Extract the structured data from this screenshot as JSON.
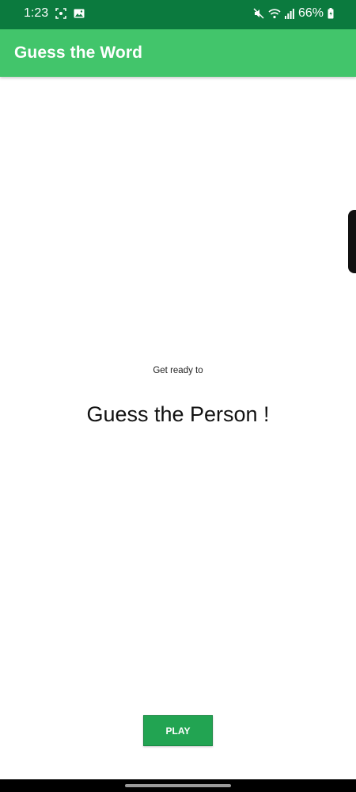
{
  "status_bar": {
    "time": "1:23",
    "battery": "66%",
    "icons": [
      "screenshot-icon",
      "image-icon",
      "mute-icon",
      "wifi-icon",
      "signal-icon",
      "battery-icon"
    ]
  },
  "app_bar": {
    "title": "Guess the Word"
  },
  "main": {
    "subtitle": "Get ready to",
    "headline": "Guess the Person !",
    "play_label": "PLAY"
  },
  "colors": {
    "status_bar": "#0b7a3e",
    "app_bar": "#42c56b",
    "play_button": "#22a452"
  }
}
